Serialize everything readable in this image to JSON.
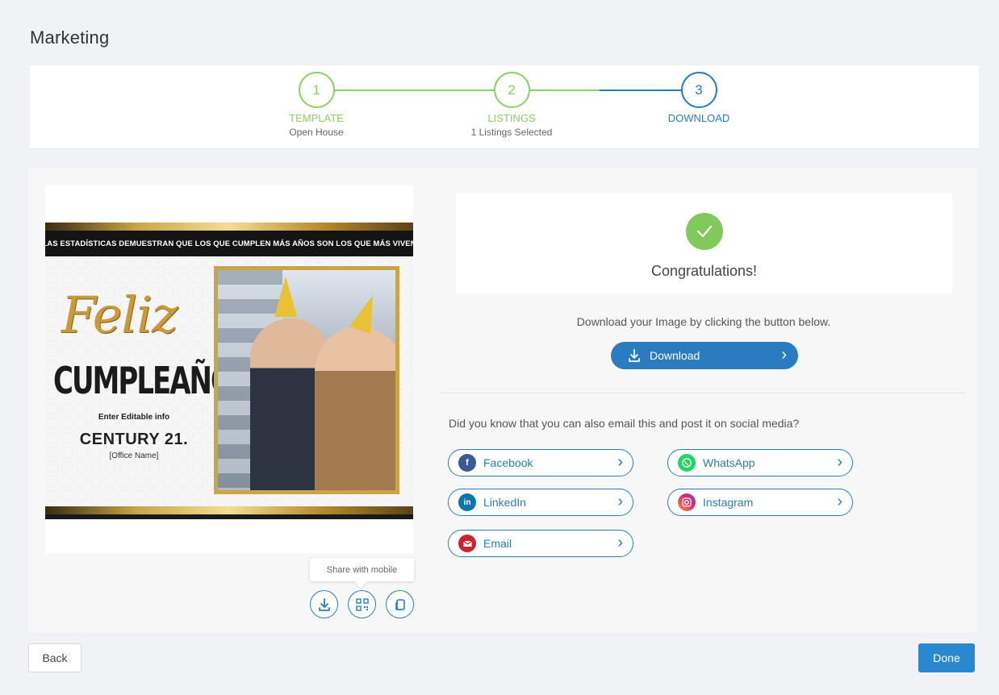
{
  "page": {
    "title": "Marketing"
  },
  "stepper": {
    "steps": [
      {
        "number": "1",
        "title": "TEMPLATE",
        "subtitle": "Open House"
      },
      {
        "number": "2",
        "title": "LISTINGS",
        "subtitle": "1 Listings Selected"
      },
      {
        "number": "3",
        "title": "DOWNLOAD",
        "subtitle": ""
      }
    ],
    "completed_color": "#8fcf6a",
    "active_color": "#2a7bbf"
  },
  "flyer": {
    "banner": "LAS ESTADÍSTICAS DEMUESTRAN QUE LOS QUE CUMPLEN MÁS AÑOS  SON LOS QUE MÁS VIVEN",
    "feliz": "Feliz",
    "cumpleanos": "CUMPLEAÑOS",
    "editable": "Enter Editable info",
    "brand": "CENTURY 21.",
    "office": "[Office Name]"
  },
  "preview_actions": {
    "tooltip": "Share with mobile",
    "icons": [
      "download-icon",
      "qr-code-icon",
      "copy-icon"
    ]
  },
  "success": {
    "heading": "Congratulations!"
  },
  "download": {
    "instruction": "Download your Image by clicking the button below.",
    "button_label": "Download"
  },
  "social": {
    "prompt": "Did you know that you can also email this and post it on social media?",
    "buttons": [
      {
        "label": "Facebook",
        "icon": "facebook-icon",
        "color": "#3b5998"
      },
      {
        "label": "WhatsApp",
        "icon": "whatsapp-icon",
        "color": "#25d366"
      },
      {
        "label": "LinkedIn",
        "icon": "linkedin-icon",
        "color": "#0e76a8"
      },
      {
        "label": "Instagram",
        "icon": "instagram-icon",
        "color": "#c13584"
      },
      {
        "label": "Email",
        "icon": "email-icon",
        "color": "#c8242f"
      }
    ]
  },
  "footer": {
    "back_label": "Back",
    "done_label": "Done"
  }
}
